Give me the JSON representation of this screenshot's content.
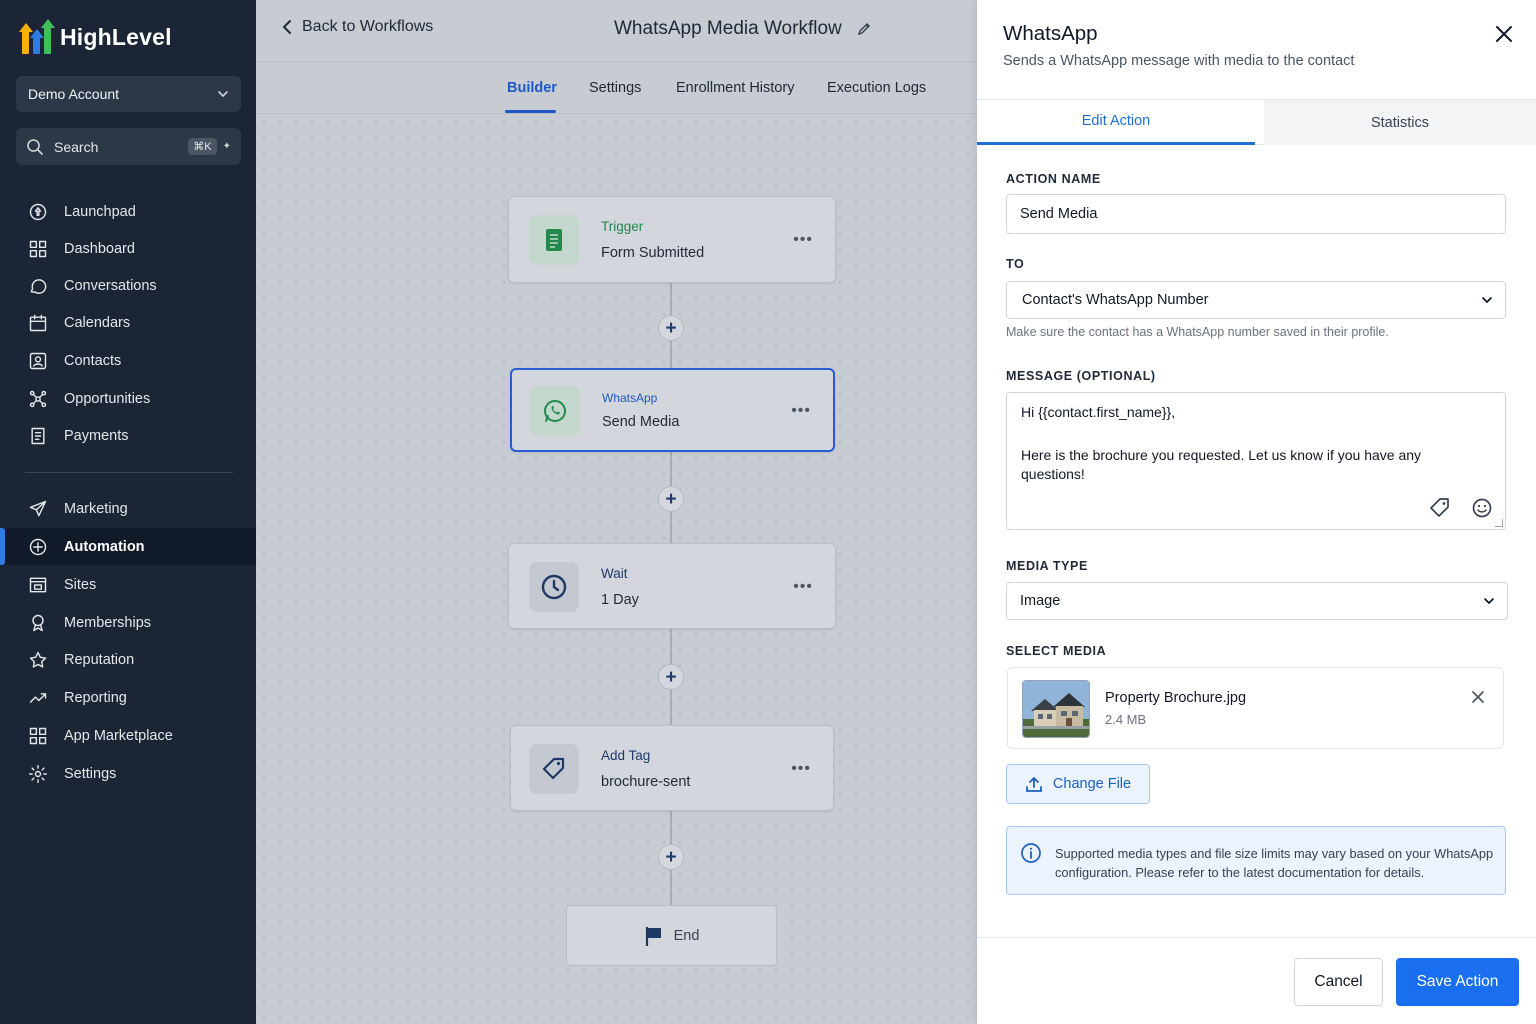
{
  "sidebar": {
    "logo_text": "HighLevel",
    "account": "Demo Account",
    "search": {
      "label": "Search",
      "shortcut": "⌘K"
    },
    "items": [
      {
        "label": "Launchpad",
        "icon": "rocket-icon"
      },
      {
        "label": "Dashboard",
        "icon": "grid-icon"
      },
      {
        "label": "Conversations",
        "icon": "chat-icon"
      },
      {
        "label": "Calendars",
        "icon": "calendar-icon"
      },
      {
        "label": "Contacts",
        "icon": "contact-icon"
      },
      {
        "label": "Opportunities",
        "icon": "network-icon"
      },
      {
        "label": "Payments",
        "icon": "receipt-icon"
      },
      {
        "label": "Marketing",
        "icon": "send-icon"
      },
      {
        "label": "Automation",
        "icon": "automation-icon",
        "active": true
      },
      {
        "label": "Sites",
        "icon": "sites-icon"
      },
      {
        "label": "Memberships",
        "icon": "badge-icon"
      },
      {
        "label": "Reputation",
        "icon": "star-icon"
      },
      {
        "label": "Reporting",
        "icon": "trend-icon"
      },
      {
        "label": "App Marketplace",
        "icon": "apps-icon"
      },
      {
        "label": "Settings",
        "icon": "gear-icon"
      }
    ]
  },
  "workflow": {
    "back_label": "Back to Workflows",
    "title": "WhatsApp Media Workflow",
    "tabs": [
      "Builder",
      "Settings",
      "Enrollment History",
      "Execution Logs"
    ],
    "nodes": [
      {
        "sub": "Trigger",
        "main": "Form Submitted"
      },
      {
        "sub": "WhatsApp",
        "main": "Send Media"
      },
      {
        "sub": "Wait",
        "main": "1 Day"
      },
      {
        "sub": "Add Tag",
        "main": "brochure-sent"
      }
    ],
    "end_label": "End"
  },
  "panel": {
    "title": "WhatsApp",
    "subtitle": "Sends a WhatsApp message with media to the contact",
    "tabs": [
      "Edit Action",
      "Statistics"
    ],
    "action_name_label": "ACTION NAME",
    "action_name_value": "Send Media",
    "to_label": "TO",
    "to_value": "Contact's WhatsApp Number",
    "to_help": "Make sure the contact has a WhatsApp number saved in their profile.",
    "message_label": "MESSAGE (OPTIONAL)",
    "message_line1": "Hi {{contact.first_name}},",
    "message_line2": "Here is the brochure you requested. Let us know if you have any",
    "message_line3": "questions!",
    "media_type_label": "MEDIA TYPE",
    "media_type_value": "Image",
    "select_media_label": "SELECT MEDIA",
    "file_name": "Property Brochure.jpg",
    "file_size": "2.4 MB",
    "change_file": "Change File",
    "info_text": "Supported media types and file size limits may vary based on your WhatsApp configuration. Please refer to the latest documentation for details.",
    "cancel": "Cancel",
    "save": "Save Action"
  },
  "colors": {
    "sidebar_bg": "#1b2535",
    "accent": "#1a6ef0",
    "trigger_green": "#1f8a4c",
    "whatsapp_blue": "#1f58c9"
  }
}
